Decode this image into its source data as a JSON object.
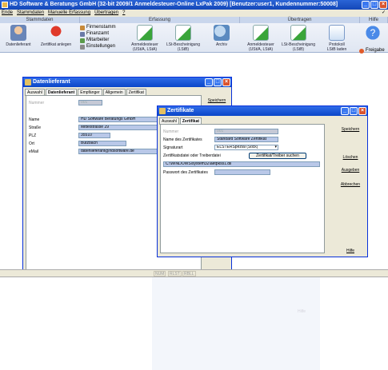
{
  "window": {
    "title": "HD Software & Beratungs GmbH (32-bit 2009/1  Anmeldesteuer-Online LxPak 2009) [Benutzer:user1, Kundennummer:50008]"
  },
  "menu": {
    "items": [
      "Ende",
      "Stammdaten",
      "Manuelle Erfassung",
      "Übertragen",
      "?"
    ],
    "corner": "✓"
  },
  "ribbon": {
    "groups": {
      "stammdaten": "Stammdaten",
      "erfassung": "Erfassung",
      "uebertragen": "Übertragen",
      "hilfe": "Hilfe"
    },
    "buttons": {
      "datenlieferant": "Datenlieferant",
      "zertifikat": "Zertifikat anlegen",
      "firmenstamm": "Firmenstamm",
      "finanzamt": "Finanzamt",
      "mitarbeiter": "Mitarbeiter",
      "einstellungen": "Einstellungen",
      "anmelde1": "Anmeldesteuer\n(USt/A, LStA)",
      "lstb1": "LSt-Bescheinigung\n(LStB)",
      "archiv": "Archiv",
      "anmelde2": "Anmeldesteuer\n(USt/A, LStA)",
      "lstb2": "LSt-Bescheinigung\n(LStB)",
      "protokoll": "Protokoll\nLStB laden",
      "freigabe": "Freigabe"
    },
    "colors": {
      "accent": "#1447b8",
      "ribbon": "#dfe6f2"
    }
  },
  "datenlieferant": {
    "title": "Datenlieferant",
    "tabs": [
      "Auswahl",
      "Datenlieferant",
      "Empfänger",
      "Allgemein",
      "Zertifikat"
    ],
    "fields": [
      {
        "label": "Nummer",
        "value": "001",
        "disabled": true
      },
      {
        "label": "Name",
        "value": "HD Software Beratungs GmbH"
      },
      {
        "label": "Straße",
        "value": "Mittelstrasse 29"
      },
      {
        "label": "PLZ",
        "value": "35510"
      },
      {
        "label": "Ort",
        "value": "Butzbach"
      },
      {
        "label": "eMail",
        "value": "datenlieferant@hdsoftware.de"
      }
    ],
    "save": "Speichern"
  },
  "zertifikate": {
    "title": "Zertifikate",
    "tabs": [
      "Auswahl",
      "Zertifikat"
    ],
    "nummer_label": "Nummer",
    "nummer_value": "001",
    "name_label": "Name des Zertifikates",
    "name_value": "Standard Software Zertifikat",
    "signatur_label": "Signaturart",
    "signatur_value": "ELSTERSpezial (Stick)",
    "datei_label": "Zertifikatsdatei oder Treiberdatei",
    "suchen_button": "Zertifikat/Treiber suchen",
    "datei_value": "C:\\WINDOWS\\system32\\aetpkss1.dll",
    "passwort_label": "Passwort des Zertifikates",
    "passwort_value": "",
    "side": {
      "speichern": "Speichern",
      "loeschen": "Löschen",
      "ausgeben": "Ausgeben",
      "abbrechen": "Abbrechen",
      "hilfe": "Hilfe"
    }
  },
  "status": {
    "cells": [
      "NUM",
      "RLST",
      "RBLL"
    ]
  },
  "ghost": {
    "hilfe": "Hilfe"
  }
}
